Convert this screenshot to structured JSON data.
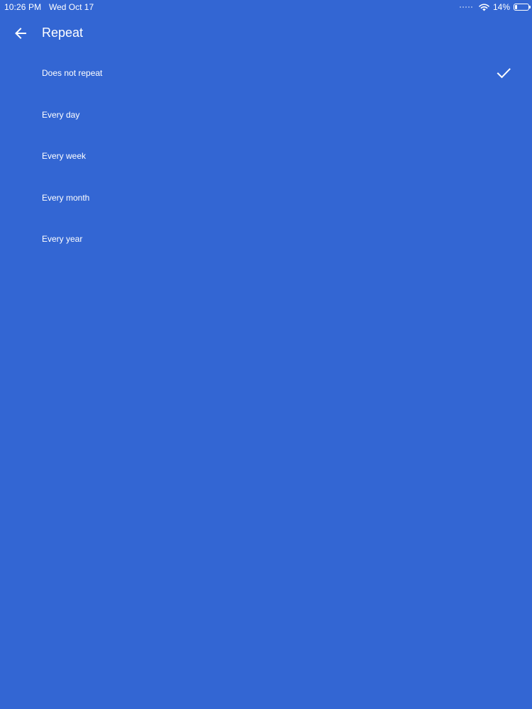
{
  "status_bar": {
    "time": "10:26 PM",
    "date": "Wed Oct 17",
    "battery_percent_text": "14%",
    "battery_level": 0.14,
    "icons": [
      "signal-dots-icon",
      "wifi-icon",
      "battery-icon"
    ]
  },
  "header": {
    "title": "Repeat",
    "back_icon": "arrow-left-icon"
  },
  "options": [
    {
      "label": "Does not repeat",
      "selected": true
    },
    {
      "label": "Every day",
      "selected": false
    },
    {
      "label": "Every week",
      "selected": false
    },
    {
      "label": "Every month",
      "selected": false
    },
    {
      "label": "Every year",
      "selected": false
    }
  ],
  "colors": {
    "background": "#3366d3",
    "foreground": "#ffffff"
  }
}
